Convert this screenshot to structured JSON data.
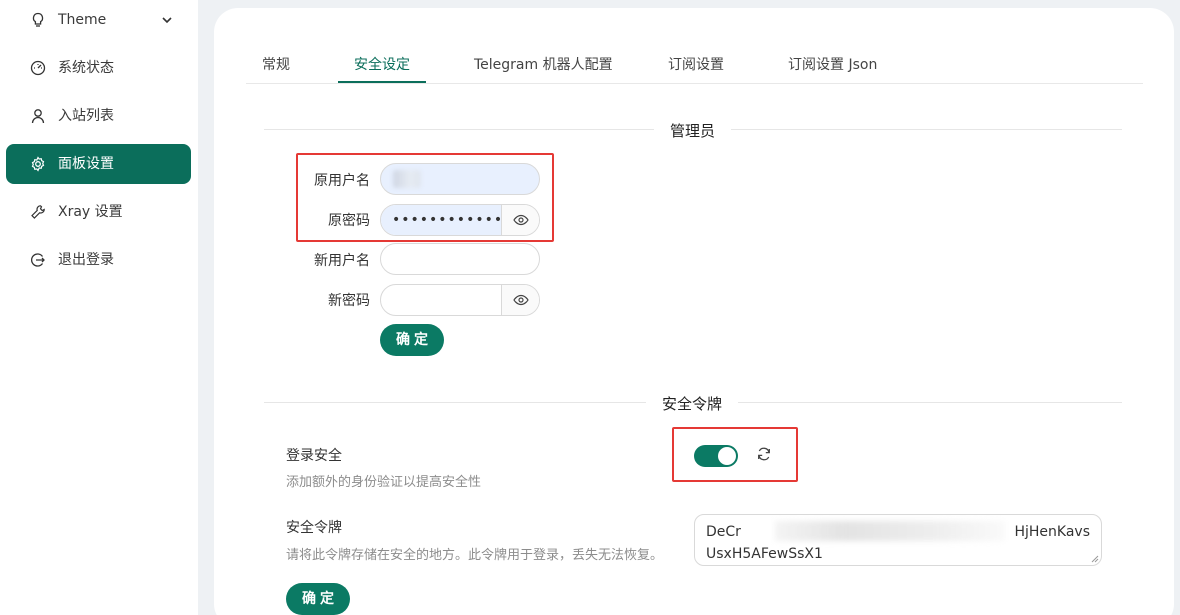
{
  "sidebar": {
    "items": [
      {
        "label": "Theme",
        "icon": "bulb-icon"
      },
      {
        "label": "系统状态",
        "icon": "dashboard-icon"
      },
      {
        "label": "入站列表",
        "icon": "user-icon"
      },
      {
        "label": "面板设置",
        "icon": "gear-icon",
        "active": true
      },
      {
        "label": "Xray 设置",
        "icon": "tool-icon"
      },
      {
        "label": "退出登录",
        "icon": "logout-icon"
      }
    ]
  },
  "tabs": [
    {
      "label": "常规"
    },
    {
      "label": "安全设定",
      "active": true
    },
    {
      "label": "Telegram 机器人配置"
    },
    {
      "label": "订阅设置"
    },
    {
      "label": "订阅设置 Json"
    }
  ],
  "admin": {
    "section_title": "管理员",
    "old_username_label": "原用户名",
    "old_password_label": "原密码",
    "old_password_value": "•••••••••••••••",
    "new_username_label": "新用户名",
    "new_password_label": "新密码",
    "confirm_label": "确定"
  },
  "token": {
    "section_title": "安全令牌",
    "login_security_title": "登录安全",
    "login_security_desc": "添加额外的身份验证以提高安全性",
    "login_security_enabled": true,
    "token_title": "安全令牌",
    "token_desc": "请将此令牌存储在安全的地方。此令牌用于登录，丢失无法恢复。",
    "token_value_start": "DeCr",
    "token_value_end": "HjHenKavs",
    "token_value_line2": "UsxH5AFewSsX1",
    "confirm_label": "确定"
  },
  "colors": {
    "accent": "#0b7a64",
    "highlight": "#e53935"
  }
}
